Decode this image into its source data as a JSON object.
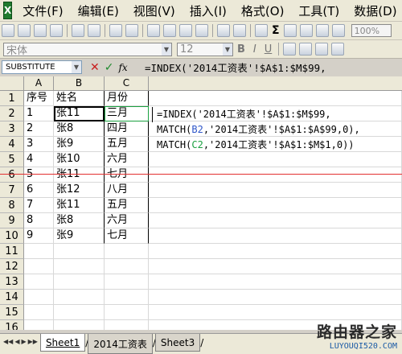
{
  "menu": [
    "文件(F)",
    "编辑(E)",
    "视图(V)",
    "插入(I)",
    "格式(O)",
    "工具(T)",
    "数据(D)"
  ],
  "toolbar": {
    "sigma": "Σ",
    "zoom": "100%"
  },
  "format_bar": {
    "font": "宋体",
    "size": "12",
    "bold": "B",
    "italic": "I",
    "underline": "U"
  },
  "formula_bar": {
    "name_box": "SUBSTITUTE",
    "cancel": "✕",
    "enter": "✓",
    "fx": "fx",
    "text": "=INDEX('2014工资表'!$A$1:$M$99,\nMATCH(B2,'2014工资表'!$A$1:$A$99,0),\nMATCH(C2,'2014工资表'!$A$1:$M$1,0))"
  },
  "grid": {
    "columns": [
      "A",
      "B",
      "C"
    ],
    "rows": [
      "1",
      "2",
      "3",
      "4",
      "5",
      "6",
      "7",
      "8",
      "9",
      "10",
      "11",
      "12",
      "13",
      "14",
      "15",
      "16"
    ],
    "data": [
      [
        "序号",
        "姓名",
        "月份"
      ],
      [
        "1",
        "张11",
        "三月"
      ],
      [
        "2",
        "张8",
        "四月"
      ],
      [
        "3",
        "张9",
        "五月"
      ],
      [
        "4",
        "张10",
        "六月"
      ],
      [
        "5",
        "张11",
        "七月"
      ],
      [
        "6",
        "张12",
        "八月"
      ],
      [
        "7",
        "张11",
        "五月"
      ],
      [
        "8",
        "张8",
        "六月"
      ],
      [
        "9",
        "张9",
        "七月"
      ]
    ],
    "cell_formula": {
      "line1": "=INDEX('2014工资表'!$A$1:$M$99,",
      "line2_pre": "MATCH(",
      "line2_ref": "B2",
      "line2_post": ",'2014工资表'!$A$1:$A$99,0),",
      "line3_pre": "MATCH(",
      "line3_ref": "C2",
      "line3_post": ",'2014工资表'!$A$1:$M$1,0))"
    }
  },
  "sheet_tabs": [
    "Sheet1",
    "2014工资表",
    "Sheet3"
  ],
  "watermark": {
    "title": "路由器之家",
    "url": "LUYOUQI520.COM"
  }
}
